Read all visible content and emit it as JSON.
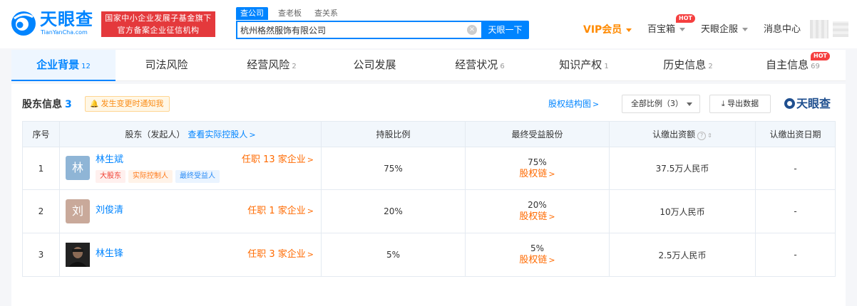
{
  "header": {
    "logo_cn": "天眼查",
    "logo_en": "TianYanCha.com",
    "gov_badge": [
      "国家中小企业发展子基金旗下",
      "官方备案企业征信机构"
    ],
    "search_tabs": [
      "查公司",
      "查老板",
      "查关系"
    ],
    "search_value": "杭州格然服饰有限公司",
    "search_button": "天眼一下",
    "nav": {
      "vip": "VIP会员",
      "baibaoxiang": "百宝箱",
      "enterprise": "天眼企服",
      "messages": "消息中心",
      "hot": "HOT"
    }
  },
  "tabs": [
    {
      "label": "企业背景",
      "count": "12"
    },
    {
      "label": "司法风险",
      "count": ""
    },
    {
      "label": "经营风险",
      "count": "2"
    },
    {
      "label": "公司发展",
      "count": ""
    },
    {
      "label": "经营状况",
      "count": "6"
    },
    {
      "label": "知识产权",
      "count": "1"
    },
    {
      "label": "历史信息",
      "count": "2"
    },
    {
      "label": "自主信息",
      "count": "69"
    }
  ],
  "section": {
    "title": "股东信息",
    "count": "3",
    "notify": "发生变更时通知我",
    "equity_chart_link": "股权结构图",
    "ratio_select": "全部比例（3）",
    "export": "导出数据",
    "brand": "天眼查"
  },
  "table": {
    "headers": {
      "index": "序号",
      "shareholder": "股东（发起人）",
      "shareholder_link": "查看实际控股人",
      "ratio": "持股比例",
      "final_share": "最终受益股份",
      "capital": "认缴出资额",
      "date": "认缴出资日期"
    },
    "rows": [
      {
        "index": "1",
        "avatar": "林",
        "avatar_color": "#8fb5d6",
        "name": "林生斌",
        "jobs": "任职 13 家企业",
        "tags": [
          "大股东",
          "实际控制人",
          "最终受益人"
        ],
        "ratio": "75%",
        "final_share": "75%",
        "chain": "股权链",
        "capital": "37.5万人民币",
        "date": "-"
      },
      {
        "index": "2",
        "avatar": "刘",
        "avatar_color": "#c9a99a",
        "name": "刘俊清",
        "jobs": "任职 1 家企业",
        "tags": [],
        "ratio": "20%",
        "final_share": "20%",
        "chain": "股权链",
        "capital": "10万人民币",
        "date": "-"
      },
      {
        "index": "3",
        "avatar": "",
        "avatar_color": "#2a2a2a",
        "name": "林生锋",
        "jobs": "任职 3 家企业",
        "tags": [],
        "ratio": "5%",
        "final_share": "5%",
        "chain": "股权链",
        "capital": "2.5万人民币",
        "date": "-"
      }
    ]
  }
}
